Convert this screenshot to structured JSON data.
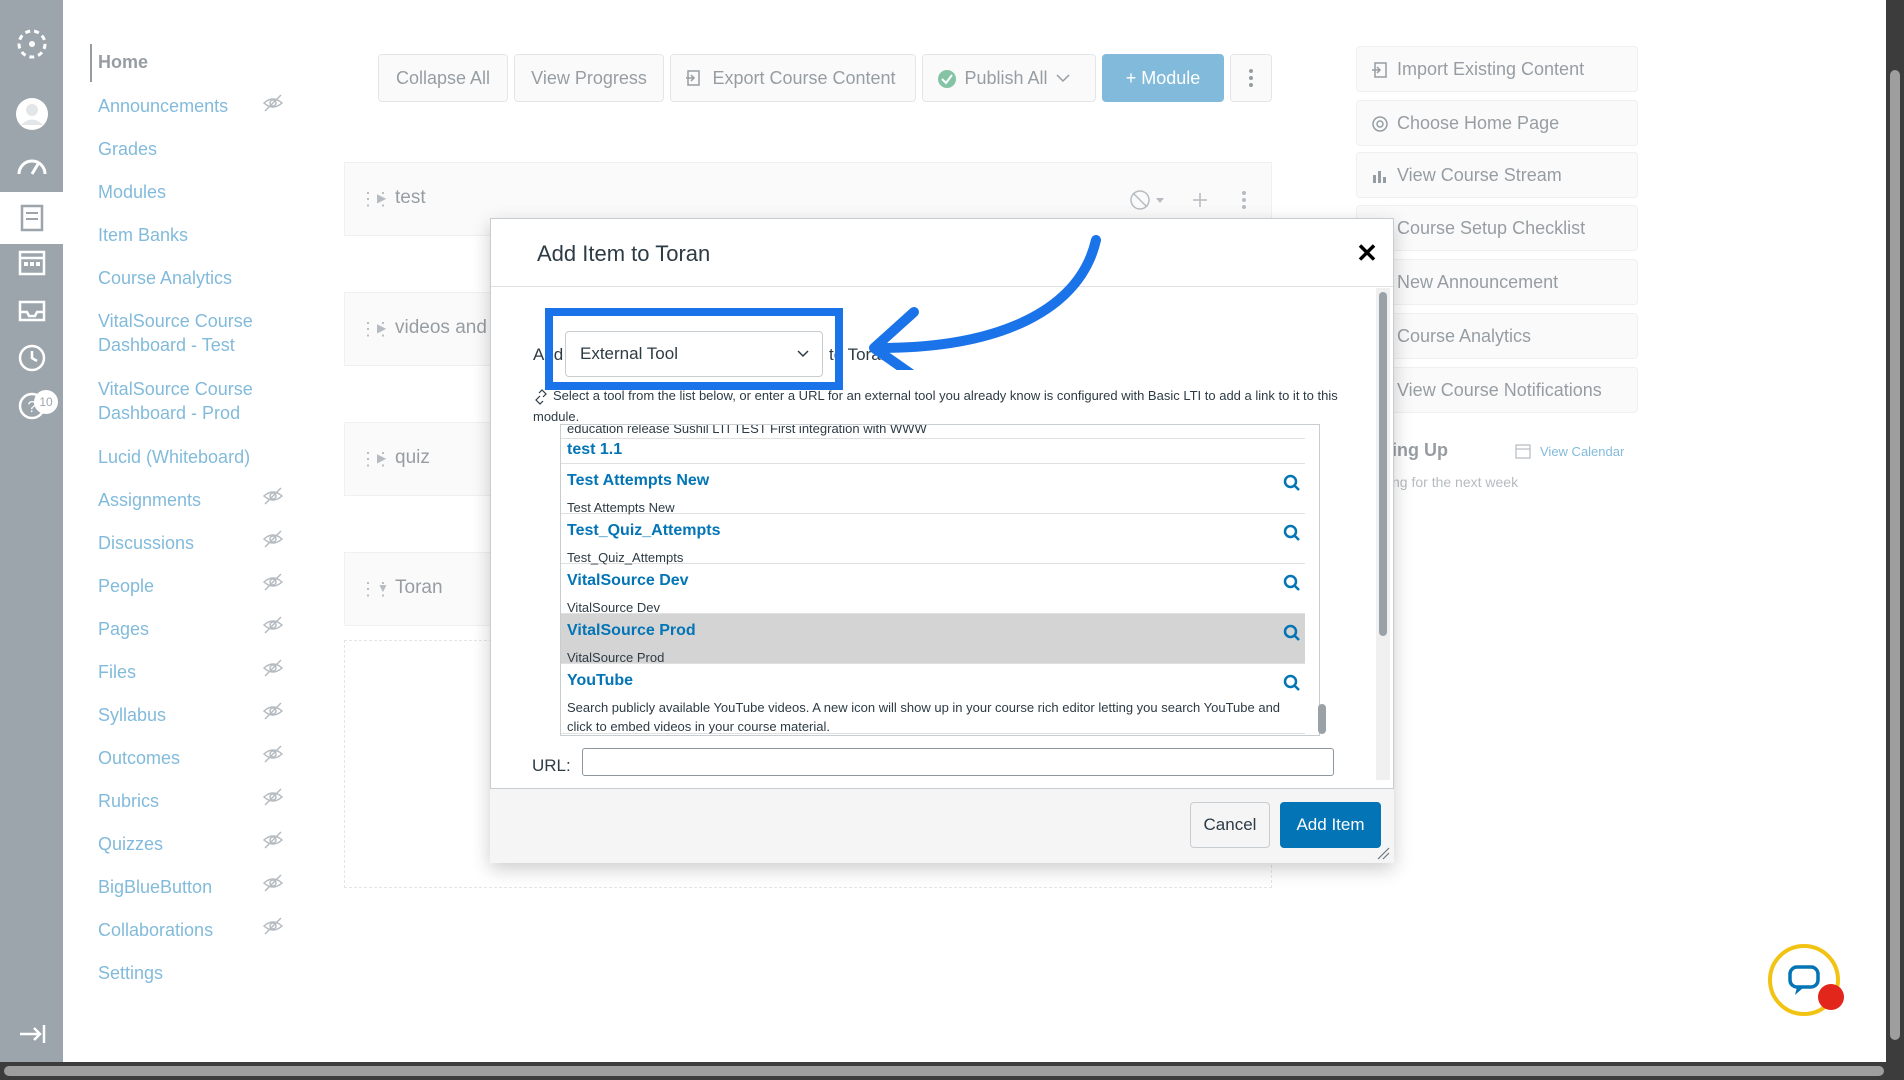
{
  "colors": {
    "nav_bg": "#394b58",
    "link": "#0374b5",
    "primary": "#0374b5",
    "annotation": "#1a73e8",
    "chat_ring": "#f2c313",
    "chat_dot": "#e3261b"
  },
  "global_nav": {
    "icons": [
      "canvas-logo-icon",
      "account-icon",
      "dashboard-icon",
      "courses-icon",
      "calendar-icon",
      "inbox-icon",
      "history-icon",
      "help-icon",
      "collapse-nav-icon"
    ],
    "help_badge": "10"
  },
  "course_nav": {
    "items": [
      {
        "label": "Home",
        "hidden": false
      },
      {
        "label": "Announcements",
        "hidden": true
      },
      {
        "label": "Grades",
        "hidden": false
      },
      {
        "label": "Modules",
        "hidden": false
      },
      {
        "label": "Item Banks",
        "hidden": false
      },
      {
        "label": "Course Analytics",
        "hidden": false
      },
      {
        "label": "VitalSource Course Dashboard - Test",
        "hidden": false
      },
      {
        "label": "VitalSource Course Dashboard - Prod",
        "hidden": false
      },
      {
        "label": "Lucid (Whiteboard)",
        "hidden": false
      },
      {
        "label": "Assignments",
        "hidden": true
      },
      {
        "label": "Discussions",
        "hidden": true
      },
      {
        "label": "People",
        "hidden": true
      },
      {
        "label": "Pages",
        "hidden": true
      },
      {
        "label": "Files",
        "hidden": true
      },
      {
        "label": "Syllabus",
        "hidden": true
      },
      {
        "label": "Outcomes",
        "hidden": true
      },
      {
        "label": "Rubrics",
        "hidden": true
      },
      {
        "label": "Quizzes",
        "hidden": true
      },
      {
        "label": "BigBlueButton",
        "hidden": true
      },
      {
        "label": "Collaborations",
        "hidden": true
      },
      {
        "label": "Settings",
        "hidden": false
      }
    ]
  },
  "toolbar": {
    "collapse_all": "Collapse All",
    "view_progress": "View Progress",
    "export": "Export Course Content",
    "publish_all": "Publish All",
    "add_module": "+ Module"
  },
  "modules": [
    {
      "title": "test"
    },
    {
      "title": "videos and"
    },
    {
      "title": "quiz"
    },
    {
      "title": "Toran"
    }
  ],
  "sidebar": {
    "buttons": [
      "Import Existing Content",
      "Choose Home Page",
      "View Course Stream",
      "Course Setup Checklist",
      "New Announcement",
      "Course Analytics",
      "View Course Notifications"
    ],
    "coming_up": "ing Up",
    "view_calendar": "View Calendar",
    "nothing": "ng for the next week"
  },
  "modal": {
    "title": "Add Item to Toran",
    "add_label": "Add",
    "to_label": "to Toran",
    "item_type": "External Tool",
    "hint": "Select a tool from the list below, or enter a URL for an external tool you already know is configured with Basic LTI to add a link to it to this module.",
    "tools": [
      {
        "name": "",
        "desc": "education release Sushil LTI TEST First integration with WWW"
      },
      {
        "name": "test 1.1",
        "desc": ""
      },
      {
        "name": "Test Attempts New",
        "desc": "Test Attempts New"
      },
      {
        "name": "Test_Quiz_Attempts",
        "desc": "Test_Quiz_Attempts"
      },
      {
        "name": "VitalSource Dev",
        "desc": "VitalSource Dev"
      },
      {
        "name": "VitalSource Prod",
        "desc": "VitalSource Prod",
        "selected": true
      },
      {
        "name": "YouTube",
        "desc": "Search publicly available YouTube videos. A new icon will show up in your course rich editor letting you search YouTube and click to embed videos in your course material."
      }
    ],
    "url_label": "URL:",
    "url_value": "",
    "cancel": "Cancel",
    "add_item": "Add Item"
  }
}
